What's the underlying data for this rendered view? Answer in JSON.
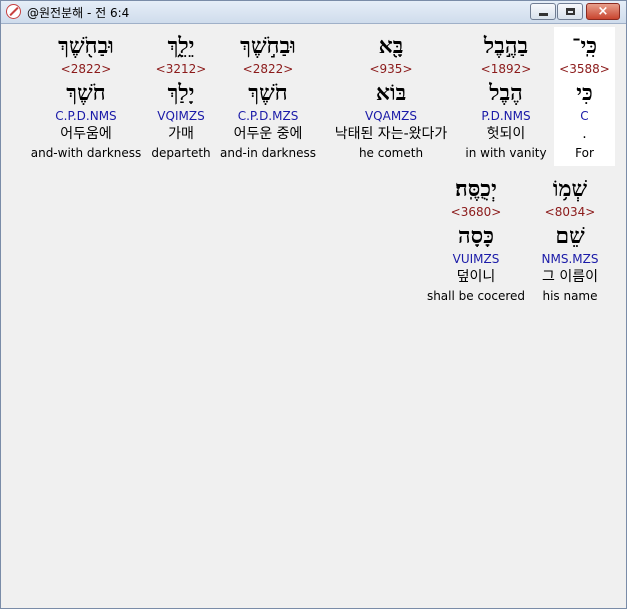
{
  "window": {
    "title": "@원전분해 - 전 6:4",
    "app_icon": "bible-app-icon",
    "buttons": {
      "minimize": "minimize-icon",
      "maximize": "maximize-icon",
      "close": "×"
    }
  },
  "verse_rows": [
    {
      "words": [
        {
          "heb": "כִּֽי־",
          "strong": "<3588>",
          "root": "כִּי",
          "morph": "C",
          "kor": ".",
          "eng": "For",
          "selected": true
        },
        {
          "heb": "בַהֶ֣בֶל",
          "strong": "<1892>",
          "root": "הֶבֶל",
          "morph": "P.D.NMS",
          "kor": "헛되이",
          "eng": "in with vanity"
        },
        {
          "heb": "בָּ֖א",
          "strong": "<935>",
          "root": "בּוֹא",
          "morph": "VQAMZS",
          "kor": "낙태된 자는-왔다가",
          "eng": "he cometh"
        },
        {
          "heb": "וּבַחֹ֣שֶׁךְ",
          "strong": "<2822>",
          "root": "חֹשֶׁךְ",
          "morph": "C.P.D.MZS",
          "kor": "어두운 중에",
          "eng": "and-in darkness"
        },
        {
          "heb": "יֵלֵ֑ךְ",
          "strong": "<3212>",
          "root": "יָלַךְ",
          "morph": "VQIMZS",
          "kor": "가매",
          "eng": "departeth"
        },
        {
          "heb": "וּבַחֹ֖שֶׁךְ",
          "strong": "<2822>",
          "root": "חֹשֶׁךְ",
          "morph": "C.P.D.NMS",
          "kor": "어두움에",
          "eng": "and-with darkness"
        }
      ]
    },
    {
      "words": [
        {
          "heb": "שְׁמ֥וֹ",
          "strong": "<8034>",
          "root": "שֵׁם",
          "morph": "NMS.MZS",
          "kor": "그 이름이",
          "eng": "his name"
        },
        {
          "heb": "יְכֻסֶּֽה׃",
          "strong": "<3680>",
          "root": "כָּסָה",
          "morph": "VUIMZS",
          "kor": "덮이니",
          "eng": "shall be cocered"
        }
      ]
    }
  ]
}
